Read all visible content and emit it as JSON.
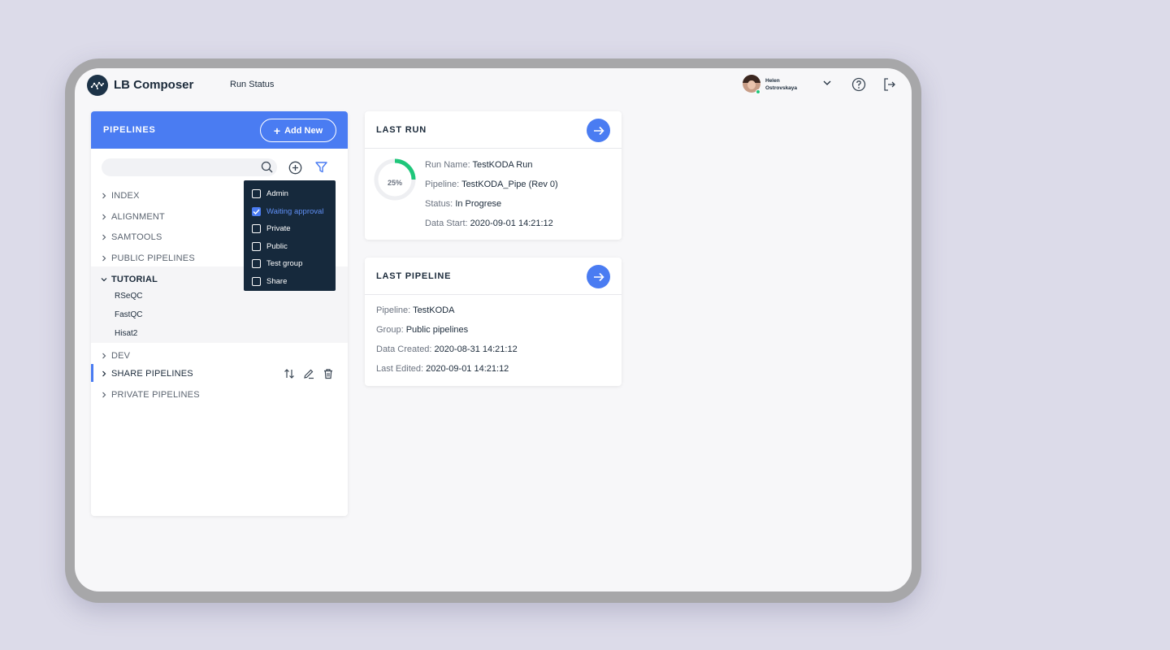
{
  "header": {
    "app_name": "LB Composer",
    "nav_run_status": "Run Status",
    "user_first": "Helen",
    "user_last": "Ostrovskaya"
  },
  "pipelines": {
    "title": "PIPELINES",
    "add_label": "Add New",
    "search_placeholder": "",
    "tree": [
      "INDEX",
      "ALIGNMENT",
      "SAMTOOLS",
      "PUBLIC PIPELINES",
      "TUTORIAL",
      "DEV",
      "SHARE PIPELINES",
      "PRIVATE PIPELINES"
    ],
    "tutorial_children": [
      "RSeQC",
      "FastQC",
      "Hisat2"
    ]
  },
  "filter": {
    "options": [
      "Admin",
      "Waiting approval",
      "Private",
      "Public",
      "Test group",
      "Share"
    ],
    "checked": [
      false,
      true,
      false,
      false,
      false,
      false
    ]
  },
  "last_run": {
    "title": "LAST RUN",
    "progress": 0.25,
    "progress_label": "25%",
    "rows": [
      {
        "k": "Run Name:",
        "v": "TestKODA Run"
      },
      {
        "k": "Pipeline:",
        "v": "TestKODA_Pipe (Rev 0)"
      },
      {
        "k": "Status:",
        "v": "In Progrese"
      },
      {
        "k": "Data Start:",
        "v": "2020-09-01 14:21:12"
      }
    ]
  },
  "last_pipeline": {
    "title": "LAST PIPELINE",
    "rows": [
      {
        "k": "Pipeline:",
        "v": "TestKODA"
      },
      {
        "k": "Group:",
        "v": "Public pipelines"
      },
      {
        "k": "Data Created:",
        "v": "2020-08-31 14:21:12"
      },
      {
        "k": "Last Edited:",
        "v": "2020-09-01 14:21:12"
      }
    ]
  },
  "colors": {
    "accent": "#4a7cf2",
    "progress": "#1fc67a",
    "dropdown_bg": "#16293c"
  }
}
